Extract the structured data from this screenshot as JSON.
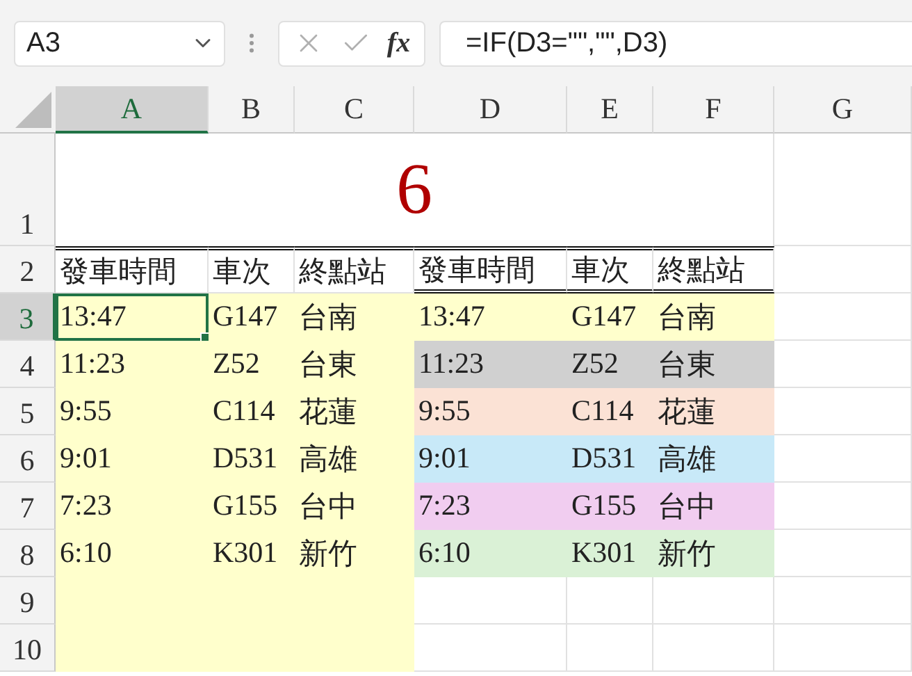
{
  "name_box": {
    "value": "A3"
  },
  "formula_bar": {
    "function_label": "fx",
    "value": "=IF(D3=\"\",\"\",D3)"
  },
  "columns": [
    {
      "label": "A",
      "selected": true
    },
    {
      "label": "B",
      "selected": false
    },
    {
      "label": "C",
      "selected": false
    },
    {
      "label": "D",
      "selected": false
    },
    {
      "label": "E",
      "selected": false
    },
    {
      "label": "F",
      "selected": false
    },
    {
      "label": "G",
      "selected": false
    }
  ],
  "row_labels": [
    {
      "label": "1",
      "selected": false
    },
    {
      "label": "2",
      "selected": false
    },
    {
      "label": "3",
      "selected": true
    },
    {
      "label": "4",
      "selected": false
    },
    {
      "label": "5",
      "selected": false
    },
    {
      "label": "6",
      "selected": false
    },
    {
      "label": "7",
      "selected": false
    },
    {
      "label": "8",
      "selected": false
    },
    {
      "label": "9",
      "selected": false
    },
    {
      "label": "10",
      "selected": false
    }
  ],
  "title": "6",
  "headers": [
    "發車時間",
    "車次",
    "終點站",
    "發車時間",
    "車次",
    "終點站"
  ],
  "data_rows": [
    {
      "color": "#ffffcc",
      "cells": [
        {
          "text": "13:47",
          "selected": true
        },
        {
          "text": "G147",
          "selected": false
        },
        {
          "text": "台南",
          "selected": false
        },
        {
          "text": "13:47",
          "selected": false
        },
        {
          "text": "G147",
          "selected": false
        },
        {
          "text": "台南",
          "selected": false
        }
      ]
    },
    {
      "color": "#d0d0d0",
      "cells": [
        {
          "text": "11:23",
          "selected": false
        },
        {
          "text": "Z52",
          "selected": false
        },
        {
          "text": "台東",
          "selected": false
        },
        {
          "text": "11:23",
          "selected": false
        },
        {
          "text": "Z52",
          "selected": false
        },
        {
          "text": "台東",
          "selected": false
        }
      ]
    },
    {
      "color": "#fbe2d5",
      "cells": [
        {
          "text": "9:55",
          "selected": false
        },
        {
          "text": "C114",
          "selected": false
        },
        {
          "text": "花蓮",
          "selected": false
        },
        {
          "text": "9:55",
          "selected": false
        },
        {
          "text": "C114",
          "selected": false
        },
        {
          "text": "花蓮",
          "selected": false
        }
      ]
    },
    {
      "color": "#c8e9f8",
      "cells": [
        {
          "text": "9:01",
          "selected": false
        },
        {
          "text": "D531",
          "selected": false
        },
        {
          "text": "高雄",
          "selected": false
        },
        {
          "text": "9:01",
          "selected": false
        },
        {
          "text": "D531",
          "selected": false
        },
        {
          "text": "高雄",
          "selected": false
        }
      ]
    },
    {
      "color": "#f1cdf0",
      "cells": [
        {
          "text": "7:23",
          "selected": false
        },
        {
          "text": "G155",
          "selected": false
        },
        {
          "text": "台中",
          "selected": false
        },
        {
          "text": "7:23",
          "selected": false
        },
        {
          "text": "G155",
          "selected": false
        },
        {
          "text": "台中",
          "selected": false
        }
      ]
    },
    {
      "color": "#daf1d6",
      "cells": [
        {
          "text": "6:10",
          "selected": false
        },
        {
          "text": "K301",
          "selected": false
        },
        {
          "text": "新竹",
          "selected": false
        },
        {
          "text": "6:10",
          "selected": false
        },
        {
          "text": "K301",
          "selected": false
        },
        {
          "text": "新竹",
          "selected": false
        }
      ]
    }
  ]
}
